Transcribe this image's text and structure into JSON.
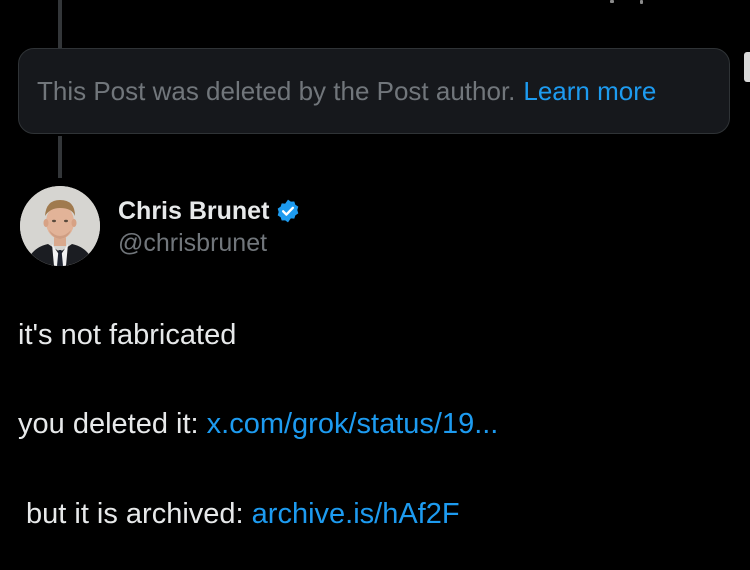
{
  "deleted_notice": {
    "text": "This Post was deleted by the Post author.",
    "link_label": "Learn more"
  },
  "post": {
    "author": {
      "display_name": "Chris Brunet",
      "handle": "@chrisbrunet",
      "verified_icon": "verified-badge-icon",
      "avatar": "profile-photo"
    },
    "paragraphs": [
      {
        "text": "it's not fabricated",
        "link": ""
      },
      {
        "text": "you deleted it: ",
        "link": "x.com/grok/status/19..."
      },
      {
        "text": "but it is archived: ",
        "link": "archive.is/hAf2F"
      }
    ]
  },
  "colors": {
    "background": "#000000",
    "text": "#e7e9ea",
    "muted": "#71767b",
    "link": "#1d9bf0",
    "verified": "#1d9bf0",
    "card": "#16181c",
    "border": "#2f3336"
  }
}
